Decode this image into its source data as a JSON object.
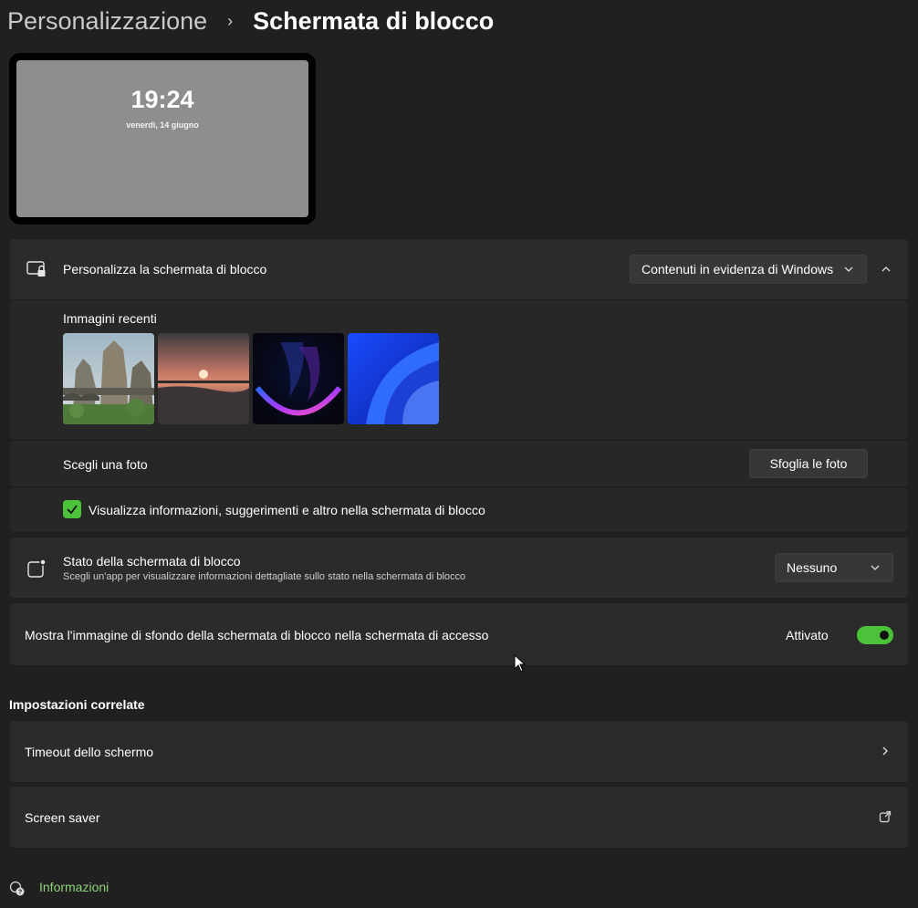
{
  "breadcrumb": {
    "parent": "Personalizzazione",
    "separator": "›",
    "current": "Schermata di blocco"
  },
  "preview": {
    "time": "19:24",
    "date": "venerdì, 14 giugno"
  },
  "personalize": {
    "label": "Personalizza la schermata di blocco",
    "selected_option": "Contenuti in evidenza di Windows",
    "recent_images_label": "Immagini recenti",
    "recent_images": [
      "rock-arch-landscape",
      "sunset-over-water",
      "dark-bloom-wallpaper",
      "blue-bloom-wallpaper"
    ],
    "choose_photo_label": "Scegli una foto",
    "browse_button": "Sfoglia le foto",
    "show_info_label": "Visualizza informazioni, suggerimenti e altro nella schermata di blocco",
    "show_info_checked": true
  },
  "status": {
    "label": "Stato della schermata di blocco",
    "description": "Scegli un'app per visualizzare informazioni dettagliate sullo stato nella schermata di blocco",
    "selected_option": "Nessuno"
  },
  "signin_background": {
    "label": "Mostra l'immagine di sfondo della schermata di blocco nella schermata di accesso",
    "state_label": "Attivato",
    "enabled": true
  },
  "related": {
    "heading": "Impostazioni correlate",
    "items": [
      {
        "label": "Timeout dello schermo",
        "icon": "chevron-right-icon"
      },
      {
        "label": "Screen saver",
        "icon": "external-link-icon"
      }
    ]
  },
  "footer": {
    "info_link": "Informazioni"
  },
  "colors": {
    "background": "#202020",
    "card": "#2b2b2b",
    "accent": "#4cc23a",
    "link": "#8fd27a"
  }
}
